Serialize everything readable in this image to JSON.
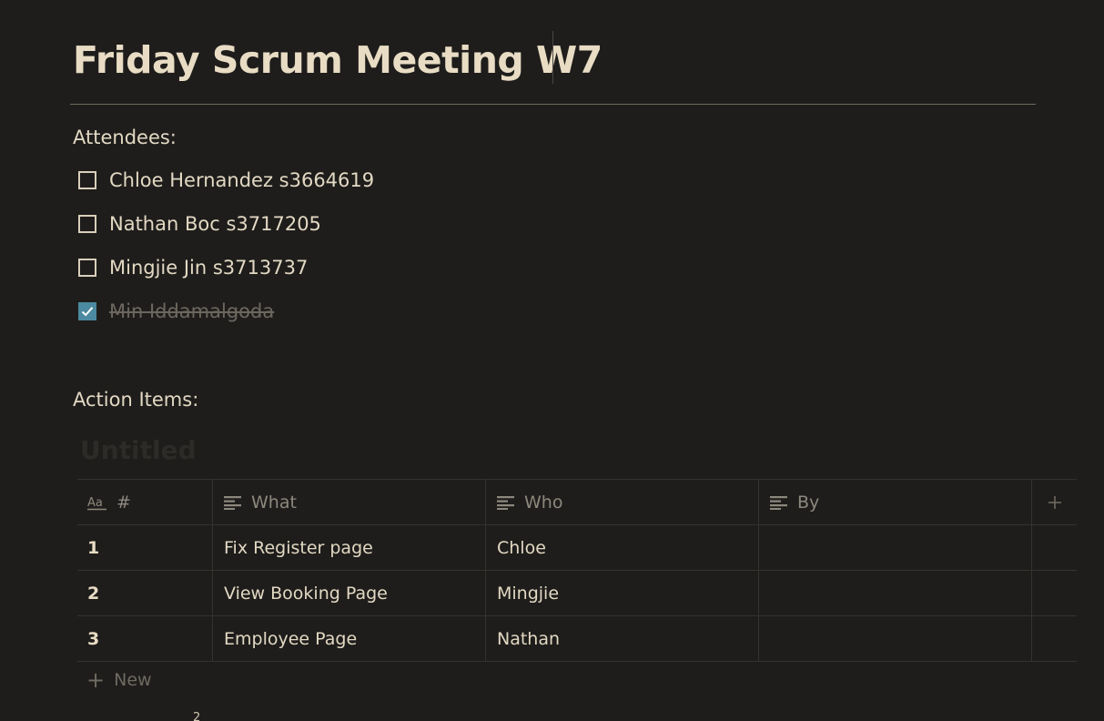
{
  "page": {
    "title": "Friday Scrum Meeting W7"
  },
  "attendees": {
    "label": "Attendees:",
    "items": [
      {
        "text": "Chloe Hernandez s3664619",
        "checked": false
      },
      {
        "text": "Nathan Boc s3717205",
        "checked": false
      },
      {
        "text": "Mingjie Jin s3713737",
        "checked": false
      },
      {
        "text": "Min Iddamalgoda",
        "checked": true
      }
    ]
  },
  "actions": {
    "label": "Action Items:",
    "database_title": "Untitled",
    "columns": [
      {
        "icon": "title-property-icon",
        "label": "#"
      },
      {
        "icon": "text-property-icon",
        "label": "What"
      },
      {
        "icon": "text-property-icon",
        "label": "Who"
      },
      {
        "icon": "text-property-icon",
        "label": "By"
      }
    ],
    "add_column_icon": "plus-icon",
    "rows": [
      {
        "num": "1",
        "what": "Fix Register page",
        "who": "Chloe",
        "by": ""
      },
      {
        "num": "2",
        "what": "View Booking Page",
        "who": "Mingjie",
        "by": ""
      },
      {
        "num": "3",
        "what": "Employee Page",
        "who": "Nathan",
        "by": ""
      }
    ],
    "new_label": "New",
    "stray_char": "2"
  },
  "colors": {
    "background": "#1e1d1b",
    "text": "#e2d8c3",
    "checkbox_checked": "#4b8aa0",
    "muted": "#8d887d"
  }
}
